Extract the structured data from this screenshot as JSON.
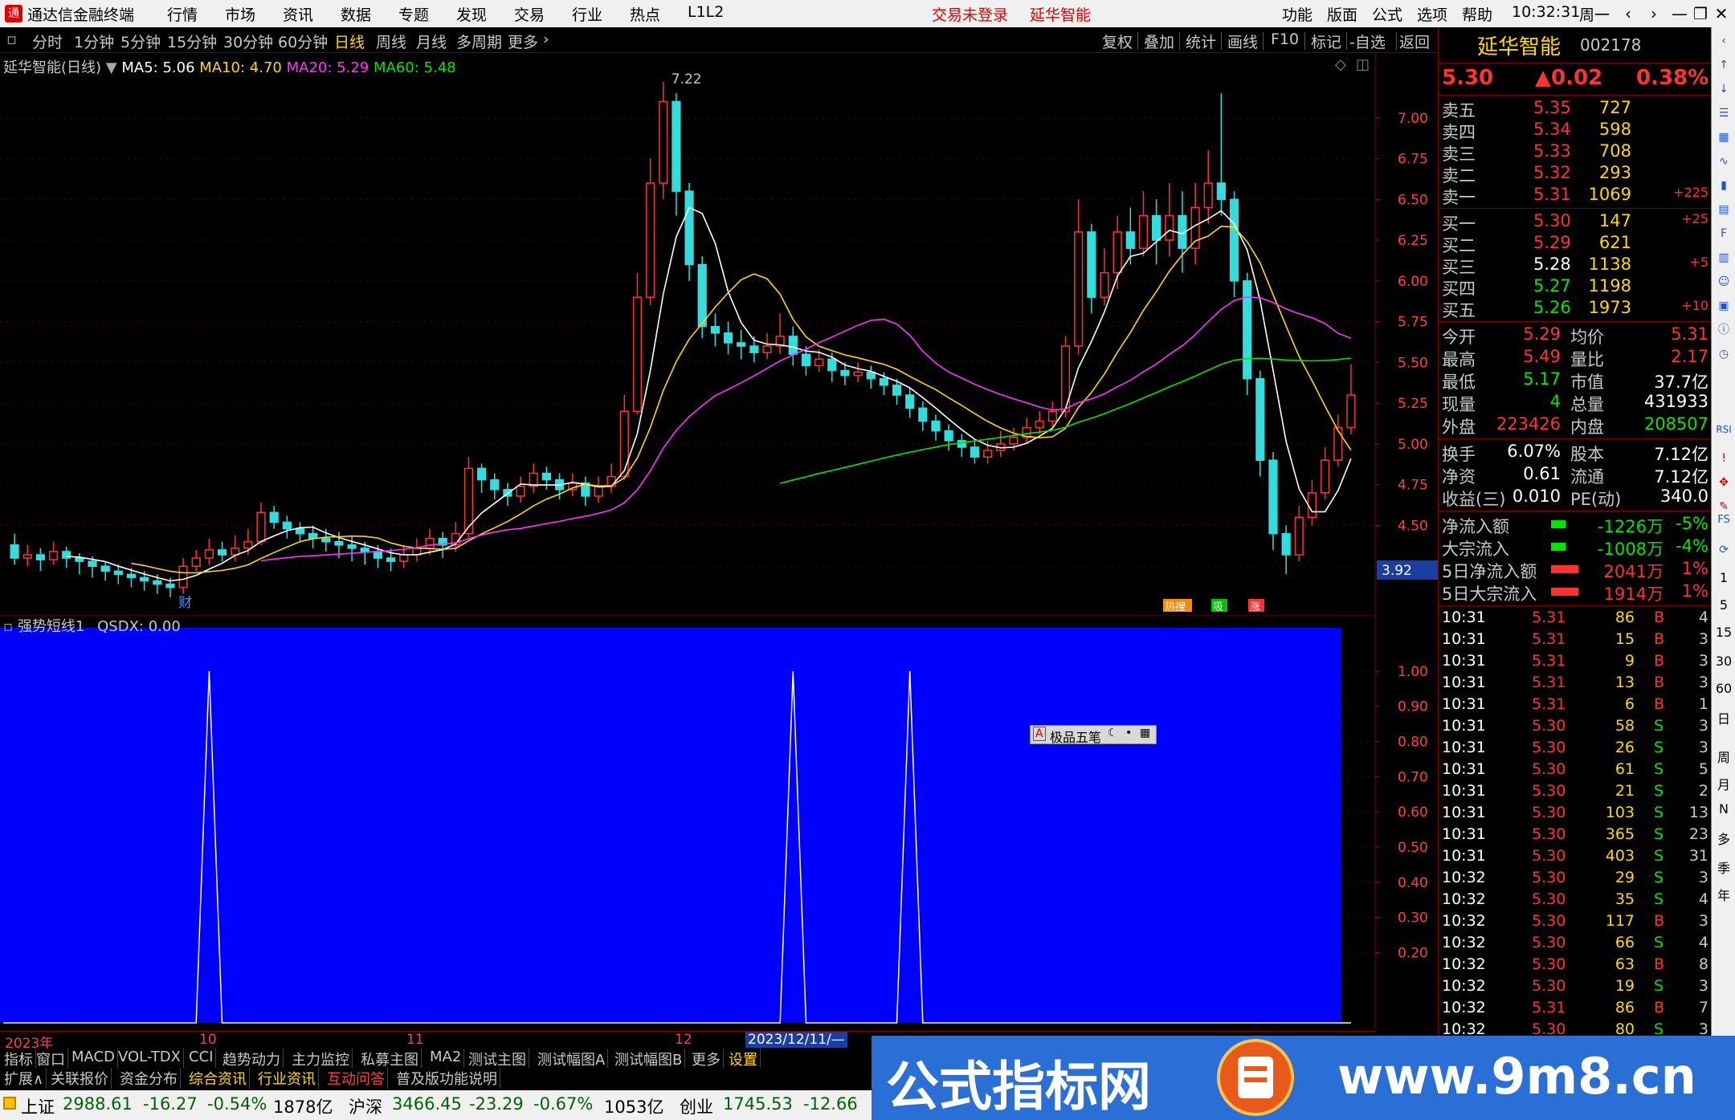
{
  "menubar": {
    "app_title": "通达信金融终端",
    "menus": [
      "行情",
      "市场",
      "资讯",
      "数据",
      "专题",
      "发现",
      "交易",
      "行业",
      "热点",
      "L1L2"
    ],
    "login_status": "交易未登录",
    "stock_name": "延华智能",
    "right_menus": [
      "功能",
      "版面",
      "公式",
      "选项",
      "帮助"
    ],
    "time": "10:32:31",
    "weekday": "周一"
  },
  "periodbar": {
    "periods": [
      "分时",
      "1分钟",
      "5分钟",
      "15分钟",
      "30分钟",
      "60分钟",
      "日线",
      "周线",
      "月线",
      "多周期",
      "更多"
    ],
    "active": "日线",
    "tools": [
      "复权",
      "叠加",
      "统计",
      "画线",
      "F10",
      "标记",
      "-自选",
      "返回"
    ]
  },
  "main_chart": {
    "legend_name": "延华智能(日线)",
    "ma": [
      {
        "label": "MA5: 5.06",
        "color": "#ffffff"
      },
      {
        "label": "MA10: 4.70",
        "color": "#ffd700"
      },
      {
        "label": "MA20: 5.29",
        "color": "#ff33ff"
      },
      {
        "label": "MA60: 5.48",
        "color": "#00e600"
      }
    ],
    "high_label": "7.22",
    "low_tag": "3.92",
    "y_ticks": [
      "7.00",
      "6.75",
      "6.50",
      "6.25",
      "6.00",
      "5.75",
      "5.50",
      "5.25",
      "5.00",
      "4.75",
      "4.50",
      "4.25"
    ],
    "finance_marker": "财",
    "event_markers": [
      "热搜",
      "吸",
      "涨"
    ]
  },
  "sub_chart": {
    "legend": "强势短线1",
    "value": "QSDX: 0.00",
    "y_ticks": [
      "1.00",
      "0.90",
      "0.80",
      "0.70",
      "0.60",
      "0.50",
      "0.40",
      "0.30",
      "0.20"
    ]
  },
  "popup_label": "极品五笔",
  "x_axis": {
    "labels": [
      "2023年",
      "10",
      "11",
      "12"
    ],
    "cursor_date": "2023/12/11/—"
  },
  "right_panel": {
    "stock_name": "延华智能",
    "stock_code": "002178",
    "price": "5.30",
    "change": "▲0.02",
    "change_pct": "0.38%",
    "asks": [
      {
        "label": "卖五",
        "price": "5.35",
        "vol": "727",
        "delta": ""
      },
      {
        "label": "卖四",
        "price": "5.34",
        "vol": "598",
        "delta": ""
      },
      {
        "label": "卖三",
        "price": "5.33",
        "vol": "708",
        "delta": ""
      },
      {
        "label": "卖二",
        "price": "5.32",
        "vol": "293",
        "delta": ""
      },
      {
        "label": "卖一",
        "price": "5.31",
        "vol": "1069",
        "delta": "+225"
      }
    ],
    "bids": [
      {
        "label": "买一",
        "price": "5.30",
        "vol": "147",
        "delta": "+25",
        "color": "red"
      },
      {
        "label": "买二",
        "price": "5.29",
        "vol": "621",
        "delta": "",
        "color": "red"
      },
      {
        "label": "买三",
        "price": "5.28",
        "vol": "1138",
        "delta": "+5",
        "color": "white"
      },
      {
        "label": "买四",
        "price": "5.27",
        "vol": "1198",
        "delta": "",
        "color": "green"
      },
      {
        "label": "买五",
        "price": "5.26",
        "vol": "1973",
        "delta": "+10",
        "color": "green"
      }
    ],
    "stats": [
      {
        "l1": "今开",
        "v1": "5.29",
        "c1": "red",
        "l2": "均价",
        "v2": "5.31",
        "c2": "red"
      },
      {
        "l1": "最高",
        "v1": "5.49",
        "c1": "red",
        "l2": "量比",
        "v2": "2.17",
        "c2": "red"
      },
      {
        "l1": "最低",
        "v1": "5.17",
        "c1": "green",
        "l2": "市值",
        "v2": "37.7亿",
        "c2": "white"
      },
      {
        "l1": "现量",
        "v1": "4",
        "c1": "green",
        "l2": "总量",
        "v2": "431933",
        "c2": "white"
      },
      {
        "l1": "外盘",
        "v1": "223426",
        "c1": "red",
        "l2": "内盘",
        "v2": "208507",
        "c2": "green"
      }
    ],
    "stats2": [
      {
        "l1": "换手",
        "v1": "6.07%",
        "l2": "股本",
        "v2": "7.12亿"
      },
      {
        "l1": "净资",
        "v1": "0.61",
        "l2": "流通",
        "v2": "7.12亿"
      },
      {
        "l1": "收益(三)",
        "v1": "0.010",
        "l2": "PE(动)",
        "v2": "340.0"
      }
    ],
    "flows": [
      {
        "label": "净流入额",
        "value": "-1226万",
        "pct": "-5%",
        "color": "green"
      },
      {
        "label": "大宗流入",
        "value": "-1008万",
        "pct": "-4%",
        "color": "green"
      },
      {
        "label": "5日净流入额",
        "value": "2041万",
        "pct": "1%",
        "color": "red"
      },
      {
        "label": "5日大宗流入",
        "value": "1914万",
        "pct": "1%",
        "color": "red"
      }
    ],
    "ticks": [
      {
        "t": "10:31",
        "p": "5.31",
        "v": "86",
        "d": "B",
        "n": "4"
      },
      {
        "t": "10:31",
        "p": "5.31",
        "v": "15",
        "d": "B",
        "n": "3"
      },
      {
        "t": "10:31",
        "p": "5.31",
        "v": "9",
        "d": "B",
        "n": "3"
      },
      {
        "t": "10:31",
        "p": "5.31",
        "v": "13",
        "d": "B",
        "n": "3"
      },
      {
        "t": "10:31",
        "p": "5.31",
        "v": "6",
        "d": "B",
        "n": "1"
      },
      {
        "t": "10:31",
        "p": "5.30",
        "v": "58",
        "d": "S",
        "n": "3"
      },
      {
        "t": "10:31",
        "p": "5.30",
        "v": "26",
        "d": "S",
        "n": "3"
      },
      {
        "t": "10:31",
        "p": "5.30",
        "v": "61",
        "d": "S",
        "n": "5"
      },
      {
        "t": "10:31",
        "p": "5.30",
        "v": "21",
        "d": "S",
        "n": "2"
      },
      {
        "t": "10:31",
        "p": "5.30",
        "v": "103",
        "d": "S",
        "n": "13"
      },
      {
        "t": "10:31",
        "p": "5.30",
        "v": "365",
        "d": "S",
        "n": "23"
      },
      {
        "t": "10:31",
        "p": "5.30",
        "v": "403",
        "d": "S",
        "n": "31"
      },
      {
        "t": "10:32",
        "p": "5.30",
        "v": "29",
        "d": "S",
        "n": "3"
      },
      {
        "t": "10:32",
        "p": "5.30",
        "v": "35",
        "d": "S",
        "n": "4"
      },
      {
        "t": "10:32",
        "p": "5.30",
        "v": "117",
        "d": "B",
        "n": "3"
      },
      {
        "t": "10:32",
        "p": "5.30",
        "v": "66",
        "d": "S",
        "n": "4"
      },
      {
        "t": "10:32",
        "p": "5.30",
        "v": "63",
        "d": "B",
        "n": "8"
      },
      {
        "t": "10:32",
        "p": "5.30",
        "v": "19",
        "d": "S",
        "n": "3"
      },
      {
        "t": "10:32",
        "p": "5.31",
        "v": "86",
        "d": "B",
        "n": "7"
      },
      {
        "t": "10:32",
        "p": "5.30",
        "v": "80",
        "d": "S",
        "n": "3"
      }
    ]
  },
  "side_toolbar": {
    "texts": [
      "1",
      "5",
      "15",
      "30",
      "60",
      "日",
      "周",
      "月",
      "N",
      "多",
      "季",
      "年"
    ],
    "rsi_label": "RSI",
    "fs_label": "FS"
  },
  "tabbar1": [
    "指标",
    "窗口",
    "MACD",
    "VOL-TDX",
    "CCI",
    "趋势动力",
    "主力监控",
    "私募主图",
    "MA2",
    "测试主图",
    "测试幅图A",
    "测试幅图B",
    "更多",
    "设置"
  ],
  "tabbar2": [
    "扩展∧",
    "关联报价",
    "资金分布",
    "综合资讯",
    "行业资讯",
    "互动问答",
    "普及版功能说明"
  ],
  "statusbar": {
    "sh": {
      "name": "上证",
      "value": "2988.61",
      "change": "-16.27",
      "pct": "-0.54%",
      "amount": "1878亿"
    },
    "hs": {
      "name": "沪深",
      "value": "3466.45",
      "change": "-23.29",
      "pct": "-0.67%",
      "amount": "1053亿"
    },
    "cy": {
      "name": "创业",
      "value": "1745.53",
      "change": "-12.66"
    }
  },
  "banner": {
    "title": "公式指标网",
    "url": "www.9m8.cn"
  },
  "chart_data": [
    {
      "type": "candlestick",
      "title": "延华智能(日线)",
      "y_range": [
        4.0,
        7.25
      ],
      "high_marker": 7.22,
      "low_marker": 3.92,
      "candles": [
        [
          4.38,
          4.3,
          4.45,
          4.26
        ],
        [
          4.3,
          4.32,
          4.38,
          4.25
        ],
        [
          4.32,
          4.29,
          4.36,
          4.22
        ],
        [
          4.29,
          4.34,
          4.4,
          4.26
        ],
        [
          4.34,
          4.3,
          4.37,
          4.24
        ],
        [
          4.3,
          4.28,
          4.33,
          4.2
        ],
        [
          4.28,
          4.25,
          4.31,
          4.18
        ],
        [
          4.25,
          4.22,
          4.28,
          4.16
        ],
        [
          4.22,
          4.2,
          4.26,
          4.14
        ],
        [
          4.2,
          4.18,
          4.24,
          4.12
        ],
        [
          4.18,
          4.16,
          4.22,
          4.1
        ],
        [
          4.16,
          4.14,
          4.2,
          4.08
        ],
        [
          4.14,
          4.12,
          4.18,
          4.06
        ],
        [
          4.12,
          4.25,
          4.3,
          4.08
        ],
        [
          4.25,
          4.3,
          4.35,
          4.22
        ],
        [
          4.3,
          4.35,
          4.42,
          4.26
        ],
        [
          4.35,
          4.32,
          4.4,
          4.28
        ],
        [
          4.32,
          4.36,
          4.44,
          4.28
        ],
        [
          4.36,
          4.4,
          4.48,
          4.32
        ],
        [
          4.4,
          4.58,
          4.64,
          4.38
        ],
        [
          4.58,
          4.52,
          4.62,
          4.48
        ],
        [
          4.52,
          4.48,
          4.56,
          4.42
        ],
        [
          4.48,
          4.45,
          4.52,
          4.4
        ],
        [
          4.45,
          4.42,
          4.5,
          4.36
        ],
        [
          4.42,
          4.4,
          4.48,
          4.34
        ],
        [
          4.4,
          4.38,
          4.46,
          4.3
        ],
        [
          4.38,
          4.36,
          4.44,
          4.28
        ],
        [
          4.36,
          4.34,
          4.4,
          4.26
        ],
        [
          4.34,
          4.3,
          4.38,
          4.24
        ],
        [
          4.3,
          4.28,
          4.36,
          4.22
        ],
        [
          4.28,
          4.32,
          4.38,
          4.24
        ],
        [
          4.32,
          4.36,
          4.42,
          4.28
        ],
        [
          4.36,
          4.42,
          4.48,
          4.32
        ],
        [
          4.42,
          4.38,
          4.46,
          4.3
        ],
        [
          4.38,
          4.45,
          4.52,
          4.34
        ],
        [
          4.45,
          4.85,
          4.92,
          4.42
        ],
        [
          4.85,
          4.78,
          4.88,
          4.7
        ],
        [
          4.78,
          4.72,
          4.82,
          4.66
        ],
        [
          4.72,
          4.68,
          4.76,
          4.62
        ],
        [
          4.68,
          4.74,
          4.8,
          4.64
        ],
        [
          4.74,
          4.82,
          4.88,
          4.7
        ],
        [
          4.82,
          4.78,
          4.86,
          4.72
        ],
        [
          4.78,
          4.72,
          4.82,
          4.66
        ],
        [
          4.72,
          4.76,
          4.82,
          4.68
        ],
        [
          4.76,
          4.68,
          4.8,
          4.62
        ],
        [
          4.68,
          4.74,
          4.8,
          4.64
        ],
        [
          4.74,
          4.8,
          4.88,
          4.7
        ],
        [
          4.8,
          5.2,
          5.3,
          4.78
        ],
        [
          5.2,
          5.9,
          6.05,
          5.18
        ],
        [
          5.9,
          6.6,
          6.75,
          5.85
        ],
        [
          6.6,
          7.1,
          7.22,
          6.5
        ],
        [
          7.1,
          6.55,
          7.15,
          6.4
        ],
        [
          6.55,
          6.1,
          6.6,
          6.0
        ],
        [
          6.1,
          5.72,
          6.15,
          5.65
        ],
        [
          5.72,
          5.68,
          5.8,
          5.6
        ],
        [
          5.68,
          5.62,
          5.75,
          5.55
        ],
        [
          5.62,
          5.6,
          5.7,
          5.52
        ],
        [
          5.6,
          5.56,
          5.66,
          5.5
        ],
        [
          5.56,
          5.6,
          5.68,
          5.52
        ],
        [
          5.6,
          5.66,
          5.8,
          5.55
        ],
        [
          5.66,
          5.55,
          5.72,
          5.48
        ],
        [
          5.55,
          5.48,
          5.6,
          5.42
        ],
        [
          5.48,
          5.52,
          5.58,
          5.44
        ],
        [
          5.52,
          5.45,
          5.56,
          5.38
        ],
        [
          5.45,
          5.42,
          5.5,
          5.36
        ],
        [
          5.42,
          5.44,
          5.5,
          5.38
        ],
        [
          5.44,
          5.4,
          5.48,
          5.34
        ],
        [
          5.4,
          5.36,
          5.44,
          5.3
        ],
        [
          5.36,
          5.3,
          5.4,
          5.24
        ],
        [
          5.3,
          5.22,
          5.34,
          5.16
        ],
        [
          5.22,
          5.14,
          5.26,
          5.08
        ],
        [
          5.14,
          5.08,
          5.18,
          5.02
        ],
        [
          5.08,
          5.02,
          5.12,
          4.96
        ],
        [
          5.02,
          4.98,
          5.06,
          4.92
        ],
        [
          4.98,
          4.92,
          5.02,
          4.88
        ],
        [
          4.92,
          4.96,
          5.02,
          4.88
        ],
        [
          4.96,
          5.0,
          5.08,
          4.92
        ],
        [
          5.0,
          5.04,
          5.1,
          4.96
        ],
        [
          5.04,
          5.1,
          5.16,
          5.0
        ],
        [
          5.1,
          5.14,
          5.2,
          5.06
        ],
        [
          5.14,
          5.2,
          5.26,
          5.1
        ],
        [
          5.2,
          5.6,
          5.66,
          5.16
        ],
        [
          5.6,
          6.3,
          6.5,
          5.55
        ],
        [
          6.3,
          5.9,
          6.35,
          5.8
        ],
        [
          5.9,
          6.05,
          6.2,
          5.85
        ],
        [
          6.05,
          6.3,
          6.4,
          5.95
        ],
        [
          6.3,
          6.2,
          6.45,
          6.1
        ],
        [
          6.2,
          6.4,
          6.55,
          6.15
        ],
        [
          6.4,
          6.25,
          6.5,
          6.1
        ],
        [
          6.25,
          6.4,
          6.6,
          6.15
        ],
        [
          6.4,
          6.2,
          6.55,
          6.05
        ],
        [
          6.2,
          6.45,
          6.6,
          6.1
        ],
        [
          6.45,
          6.6,
          6.8,
          6.35
        ],
        [
          6.6,
          6.5,
          7.15,
          6.4
        ],
        [
          6.5,
          6.0,
          6.55,
          5.9
        ],
        [
          6.0,
          5.4,
          6.05,
          5.3
        ],
        [
          5.4,
          4.9,
          5.45,
          4.8
        ],
        [
          4.9,
          4.45,
          4.95,
          4.35
        ],
        [
          4.45,
          4.32,
          4.5,
          4.2
        ],
        [
          4.32,
          4.55,
          4.62,
          4.28
        ],
        [
          4.55,
          4.7,
          4.78,
          4.5
        ],
        [
          4.7,
          4.9,
          4.98,
          4.66
        ],
        [
          4.9,
          5.1,
          5.18,
          4.86
        ],
        [
          5.1,
          5.3,
          5.49,
          5.06
        ]
      ],
      "ma_series": [
        "MA5",
        "MA10",
        "MA20",
        "MA60"
      ]
    },
    {
      "type": "line",
      "title": "强势短线1",
      "y_range": [
        0,
        1.05
      ],
      "series": [
        {
          "name": "QSDX",
          "peaks_at_index": [
            15,
            60,
            69
          ],
          "value": 1.0
        }
      ]
    }
  ]
}
